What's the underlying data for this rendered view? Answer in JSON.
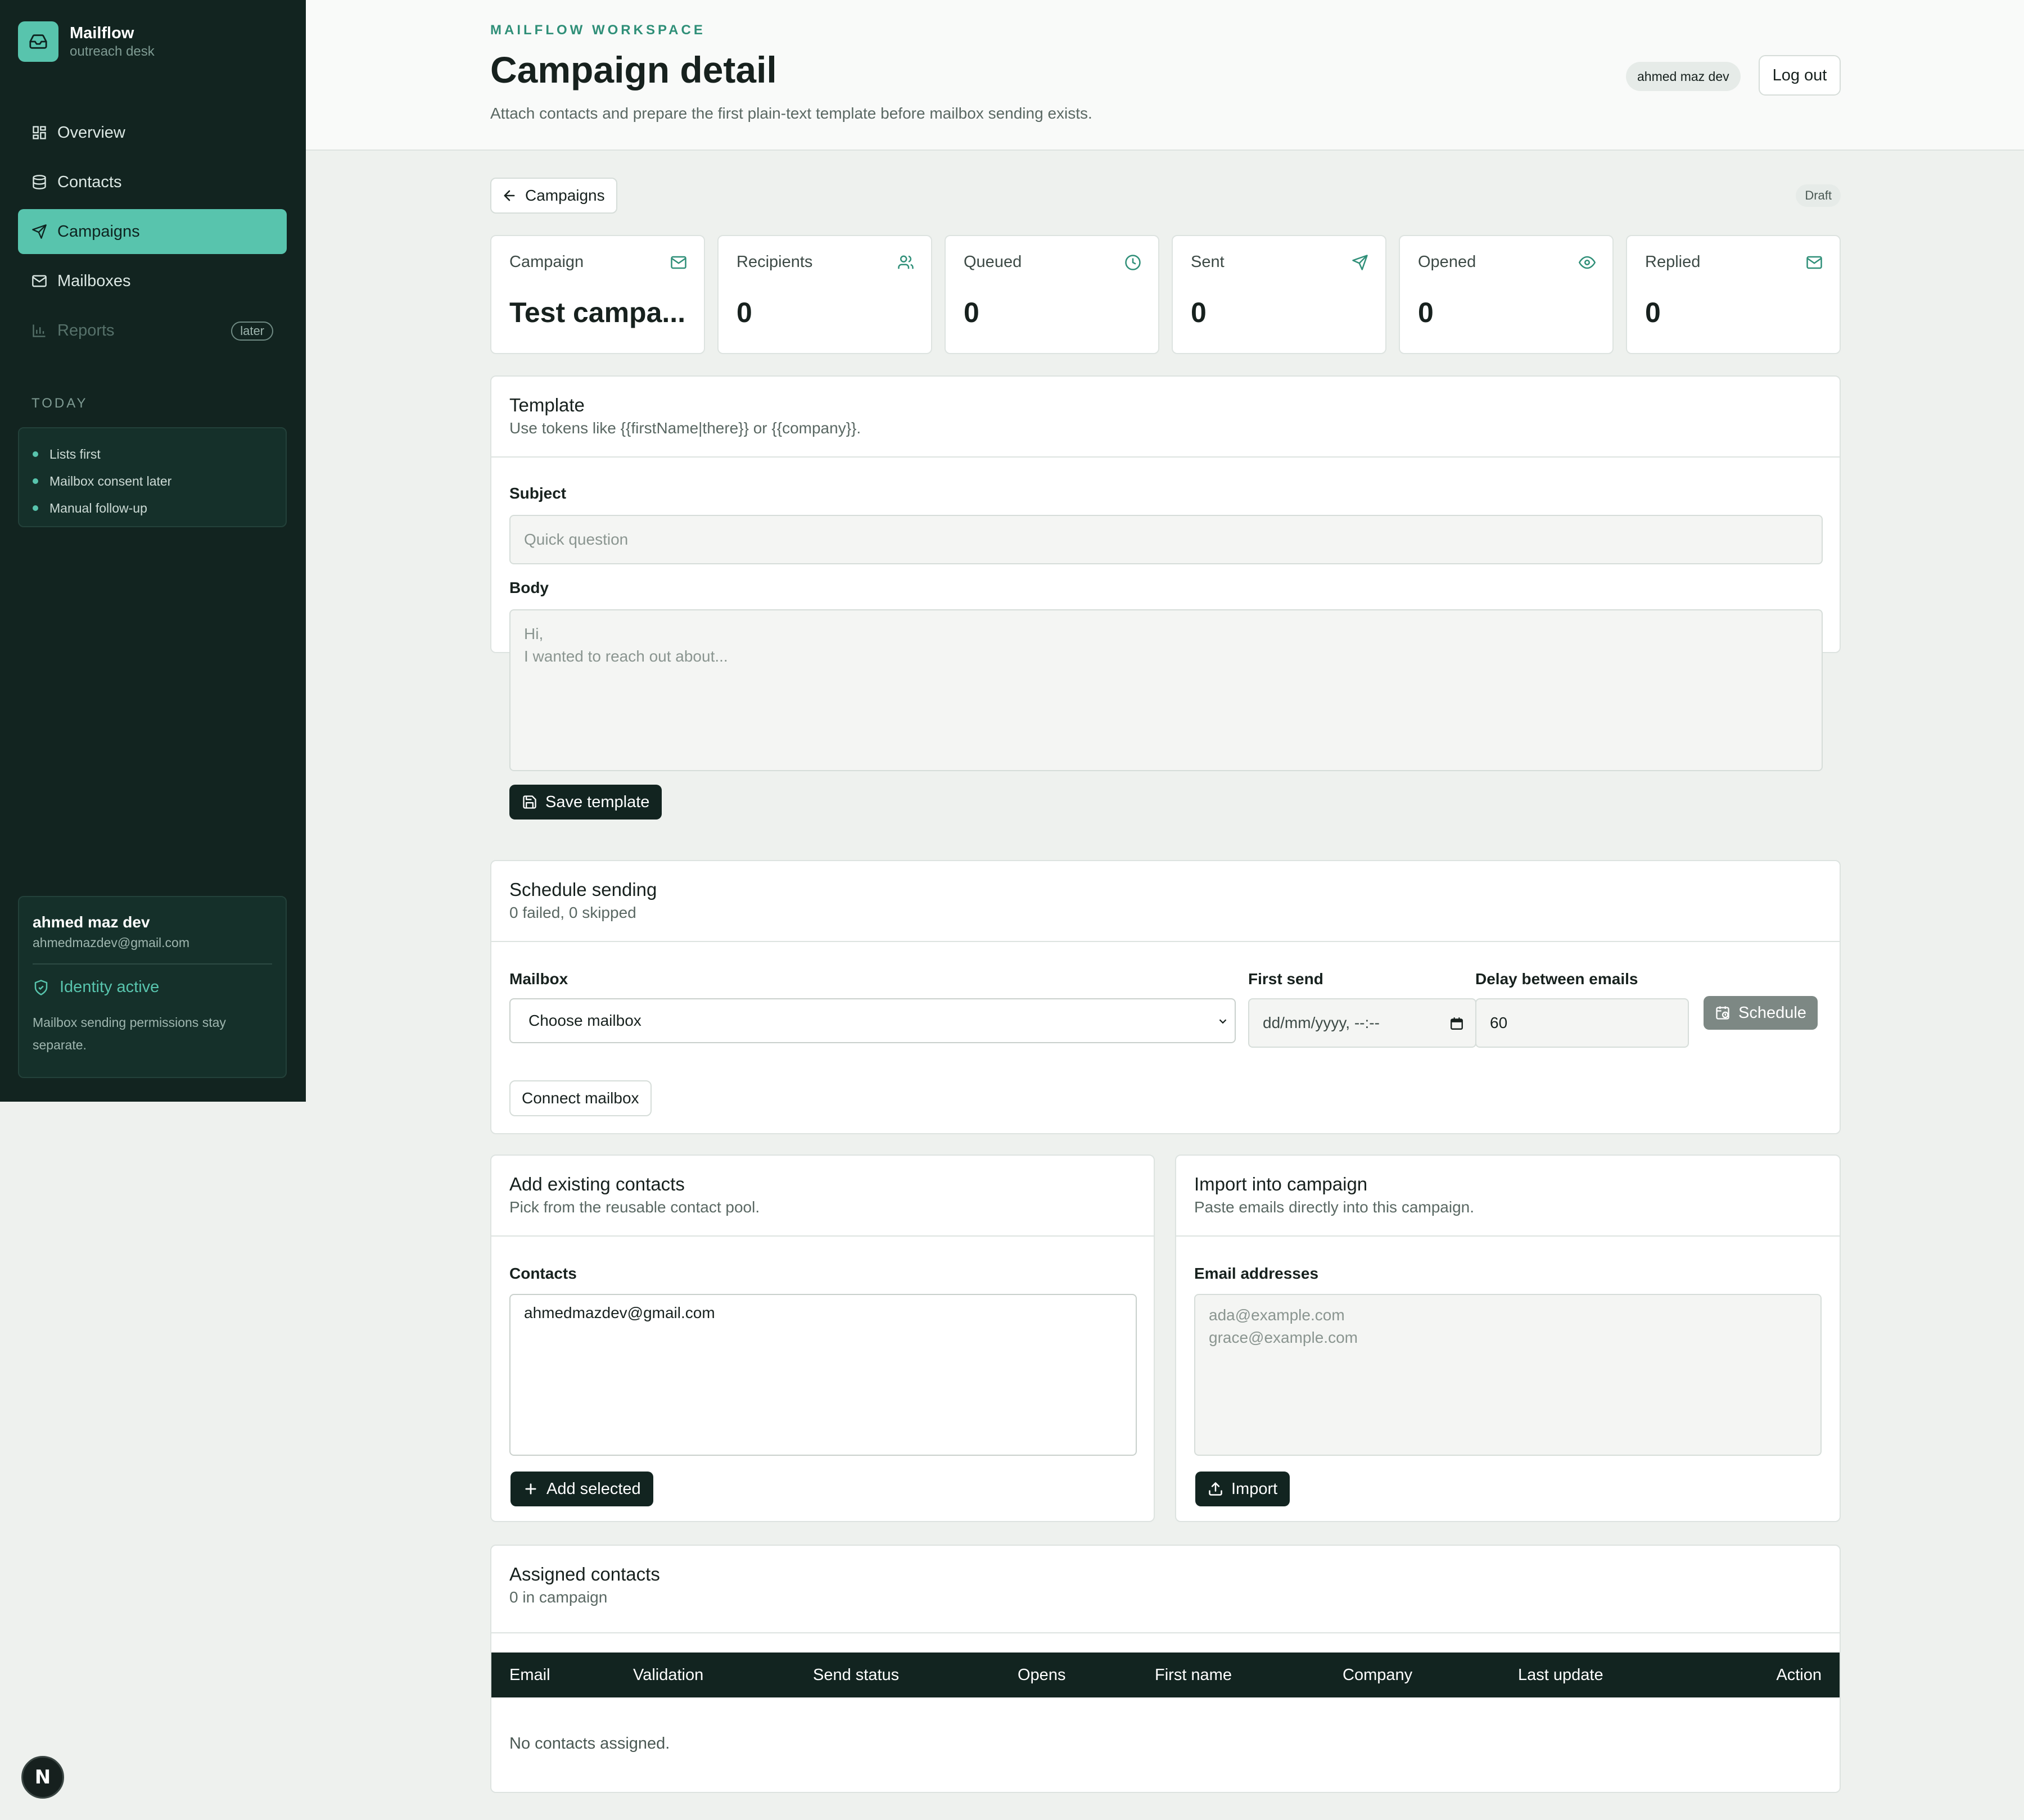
{
  "brand": {
    "name": "Mailflow",
    "subtitle": "outreach desk"
  },
  "sidebar": {
    "nav": [
      {
        "label": "Overview",
        "icon": "grid-icon",
        "active": false
      },
      {
        "label": "Contacts",
        "icon": "database-icon",
        "active": false
      },
      {
        "label": "Campaigns",
        "icon": "send-icon",
        "active": true
      },
      {
        "label": "Mailboxes",
        "icon": "mail-icon",
        "active": false
      },
      {
        "label": "Reports",
        "icon": "bar-chart-icon",
        "active": false,
        "badge": "later"
      }
    ],
    "today_label": "TODAY",
    "today_items": [
      "Lists first",
      "Mailbox consent later",
      "Manual follow-up"
    ],
    "user": {
      "name": "ahmed maz dev",
      "email": "ahmedmazdev@gmail.com",
      "identity": "Identity active",
      "note": "Mailbox sending permissions stay separate."
    }
  },
  "header": {
    "eyebrow": "MAILFLOW WORKSPACE",
    "title": "Campaign detail",
    "subtitle": "Attach contacts and prepare the first plain-text template before mailbox sending exists.",
    "user_chip": "ahmed maz dev",
    "logout": "Log out"
  },
  "toolbar": {
    "back_label": "Campaigns",
    "status": "Draft"
  },
  "stats": [
    {
      "label": "Campaign",
      "value": "Test campa...",
      "icon": "mail-icon"
    },
    {
      "label": "Recipients",
      "value": "0",
      "icon": "users-icon"
    },
    {
      "label": "Queued",
      "value": "0",
      "icon": "clock-icon"
    },
    {
      "label": "Sent",
      "value": "0",
      "icon": "send-icon"
    },
    {
      "label": "Opened",
      "value": "0",
      "icon": "eye-icon"
    },
    {
      "label": "Replied",
      "value": "0",
      "icon": "mail-icon"
    }
  ],
  "template": {
    "title": "Template",
    "desc": "Use tokens like {{firstName|there}} or {{company}}.",
    "subject_label": "Subject",
    "subject_placeholder": "Quick question",
    "body_label": "Body",
    "body_placeholder_line1": "Hi,",
    "body_placeholder_line2": "I wanted to reach out about...",
    "save_label": "Save template"
  },
  "schedule": {
    "title": "Schedule sending",
    "desc": "0 failed, 0 skipped",
    "mailbox_label": "Mailbox",
    "mailbox_value": "Choose mailbox",
    "first_send_label": "First send",
    "first_send_value": "dd/mm/yyyy, --:--",
    "delay_label": "Delay between emails",
    "delay_value": "60",
    "schedule_label": "Schedule",
    "connect_label": "Connect mailbox"
  },
  "add_contacts": {
    "title": "Add existing contacts",
    "desc": "Pick from the reusable contact pool.",
    "contacts_label": "Contacts",
    "options": [
      "ahmedmazdev@gmail.com"
    ],
    "add_label": "Add selected"
  },
  "import": {
    "title": "Import into campaign",
    "desc": "Paste emails directly into this campaign.",
    "email_label": "Email addresses",
    "placeholder_line1": "ada@example.com",
    "placeholder_line2": "grace@example.com",
    "import_label": "Import"
  },
  "assigned": {
    "title": "Assigned contacts",
    "desc": "0 in campaign",
    "columns": [
      "Email",
      "Validation",
      "Send status",
      "Opens",
      "First name",
      "Company",
      "Last update",
      "Action"
    ],
    "empty": "No contacts assigned."
  },
  "dev_badge": "N",
  "colors": {
    "accent": "#58c4ad",
    "sidebar_bg": "#122420",
    "dark_button": "#122420",
    "eyebrow": "#2f8f78"
  }
}
